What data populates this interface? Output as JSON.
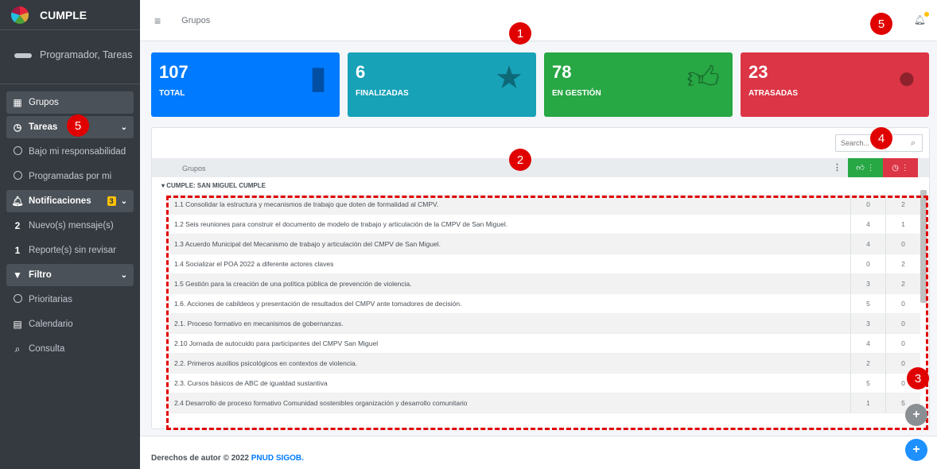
{
  "brand": "CUMPLE",
  "user": "Programador, Tareas",
  "sidebar": {
    "items": [
      {
        "label": "Grupos",
        "icon": "grid-icon"
      },
      {
        "label": "Tareas",
        "icon": "clock-icon"
      },
      {
        "label": "Bajo mi responsabilidad"
      },
      {
        "label": "Programadas por mi"
      },
      {
        "label": "Notificaciones",
        "badge": "3",
        "icon": "bell-icon"
      },
      {
        "count": "2",
        "label": "Nuevo(s) mensaje(s)"
      },
      {
        "count": "1",
        "label": "Reporte(s) sin revisar"
      },
      {
        "label": "Filtro",
        "icon": "filter-icon"
      },
      {
        "label": "Prioritarias"
      },
      {
        "label": "Calendario",
        "icon": "calendar-icon"
      },
      {
        "label": "Consulta",
        "icon": "search-icon"
      }
    ]
  },
  "header": {
    "breadcrumb": "Grupos"
  },
  "stats": [
    {
      "value": "107",
      "label": "TOTAL",
      "color": "#007bff"
    },
    {
      "value": "6",
      "label": "FINALIZADAS",
      "color": "#17a2b8"
    },
    {
      "value": "78",
      "label": "EN GESTIÓN",
      "color": "#28a745"
    },
    {
      "value": "23",
      "label": "ATRASADAS",
      "color": "#dc3545"
    }
  ],
  "table": {
    "search_placeholder": "Search...",
    "column": "Grupos",
    "group": "CUMPLE: SAN MIGUEL CUMPLE",
    "rows": [
      {
        "text": "1.1 Consolidar la estructura y mecanismos de trabajo que doten de formalidad al CMPV.",
        "ok": "0",
        "late": "2"
      },
      {
        "text": "1.2 Seis reuniones para construir el documento de modelo de trabajo y articulación de la CMPV de San Miguel.",
        "ok": "4",
        "late": "1"
      },
      {
        "text": "1.3 Acuerdo Municipal del Mecanismo de trabajo y articulación del CMPV de San Miguel.",
        "ok": "4",
        "late": "0"
      },
      {
        "text": "1.4 Socializar el POA 2022 a diferente actores claves",
        "ok": "0",
        "late": "2"
      },
      {
        "text": "1.5 Gestión para la creación de una política pública de prevención de violencia.",
        "ok": "3",
        "late": "2"
      },
      {
        "text": "1.6. Acciones de cabildeos y presentación de resultados del CMPV ante tomadores de decisión.",
        "ok": "5",
        "late": "0"
      },
      {
        "text": "2.1. Proceso formativo en mecanismos de gobernanzas.",
        "ok": "3",
        "late": "0"
      },
      {
        "text": "2.10 Jornada de autocuido para participantes del CMPV San Miguel",
        "ok": "4",
        "late": "0"
      },
      {
        "text": "2.2. Primeros auxilios psicológicos en contextos de violencia.",
        "ok": "2",
        "late": "0"
      },
      {
        "text": "2.3. Cursos básicos de ABC de igualdad sustantiva",
        "ok": "5",
        "late": "0"
      },
      {
        "text": "2.4 Desarrollo de proceso formativo Comunidad sostenibles organización y desarrollo comunitario",
        "ok": "1",
        "late": "5"
      }
    ]
  },
  "footer": {
    "text": "Derechos de autor © 2022 ",
    "link": "PNUD SIGOB."
  },
  "markers": [
    "1",
    "2",
    "3",
    "4",
    "5",
    "5"
  ]
}
